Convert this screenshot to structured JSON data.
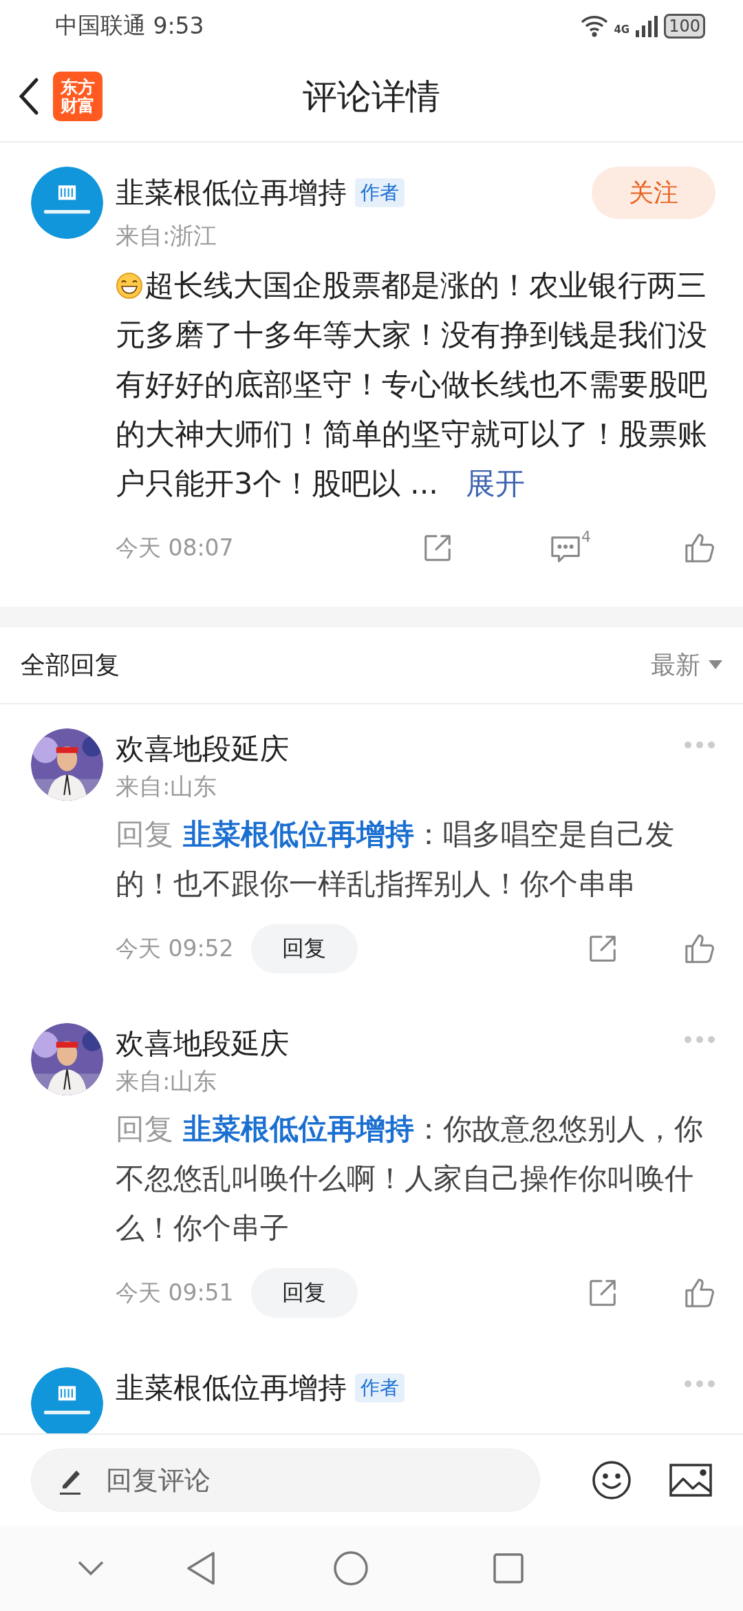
{
  "status_bar": {
    "carrier": "中国联通",
    "time": "9:53",
    "network": "4G",
    "battery": "100"
  },
  "header": {
    "logo_lines": [
      "东方",
      "财富"
    ],
    "title": "评论详情"
  },
  "post": {
    "avatar": {
      "kind": "logo"
    },
    "author": "韭菜根低位再增持",
    "badge": "作者",
    "follow": "关注",
    "location": "来自:浙江",
    "text": "超长线大国企股票都是涨的！农业银行两三元多磨了十多年等大家！没有挣到钱是我们没有好好的底部坚守！专心做长线也不需要股吧的大神大师们！简单的坚守就可以了！股票账户只能开3个！股吧以 ...",
    "expand": "展开",
    "time": "今天 08:07",
    "comment_count": "4"
  },
  "replies_header": {
    "title": "全部回复",
    "sort": "最新"
  },
  "replies": [
    {
      "author": "欢喜地段延庆",
      "location": "来自:山东",
      "reply_label": "回复",
      "mention": "韭菜根低位再增持",
      "text": "：唱多唱空是自己发的！也不跟你一样乱指挥别人！你个串串",
      "time": "今天 09:52",
      "reply_button": "回复"
    },
    {
      "author": "欢喜地段延庆",
      "location": "来自:山东",
      "reply_label": "回复",
      "mention": "韭菜根低位再增持",
      "text": "：你故意忽悠别人，你不忽悠乱叫唤什么啊！人家自己操作你叫唤什么！你个串子",
      "time": "今天 09:51",
      "reply_button": "回复"
    },
    {
      "avatar": {
        "kind": "logo"
      },
      "author": "韭菜根低位再增持",
      "badge": "作者"
    }
  ],
  "composer": {
    "placeholder": "回复评论"
  }
}
